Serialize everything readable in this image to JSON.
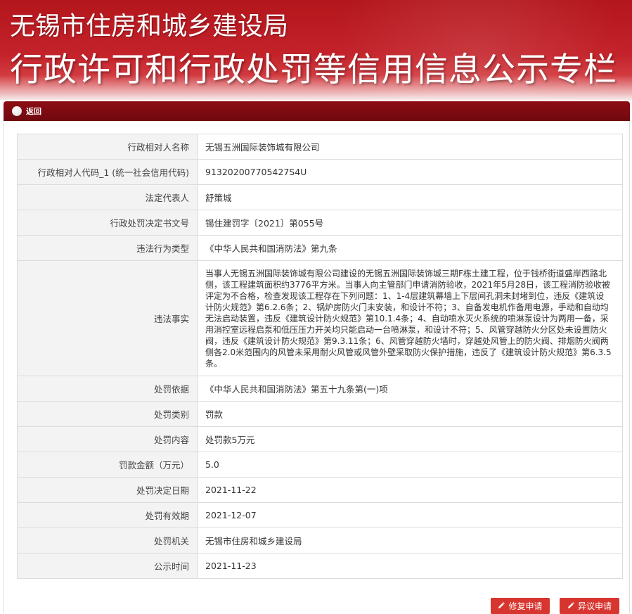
{
  "banner": {
    "line1": "无锡市住房和城乡建设局",
    "line2": "行政许可和行政处罚等信用信息公示专栏"
  },
  "panel": {
    "back_label": "返回"
  },
  "details": [
    {
      "label": "行政相对人名称",
      "value": "无锡五洲国际装饰城有限公司"
    },
    {
      "label": "行政相对人代码_1 (统一社会信用代码)",
      "value": "913202007705427S4U"
    },
    {
      "label": "法定代表人",
      "value": "舒策城"
    },
    {
      "label": "行政处罚决定书文号",
      "value": "锡住建罚字〔2021〕第055号"
    },
    {
      "label": "违法行为类型",
      "value": "《中华人民共和国消防法》第九条"
    },
    {
      "label": "违法事实",
      "value": "当事人无锡五洲国际装饰城有限公司建设的无锡五洲国际装饰城三期F栋土建工程，位于钱桥街道盛岸西路北侧，该工程建筑面积约3776平方米。当事人向主管部门申请消防验收，2021年5月28日，该工程消防验收被评定为不合格，检查发现该工程存在下列问题：1、1-4层建筑幕墙上下层间孔洞未封堵到位，违反《建筑设计防火规范》第6.2.6条；2、锅炉房防火门未安装，和设计不符；3、自备发电机作备用电源，手动和自动均无法启动装置，违反《建筑设计防火规范》第10.1.4条；4、自动喷水灭火系统的喷淋泵设计为两用一备，采用消控室远程启泵和低压压力开关均只能启动一台喷淋泵，和设计不符；5、风管穿越防火分区处未设置防火阀，违反《建筑设计防火规范》第9.3.11条；6、风管穿越防火墙时，穿越处风管上的防火阀、排烟防火阀两侧各2.0米范围内的风管未采用耐火风管或风管外壁采取防火保护措施，违反了《建筑设计防火规范》第6.3.5条。"
    },
    {
      "label": "处罚依据",
      "value": "《中华人民共和国消防法》第五十九条第(一)项"
    },
    {
      "label": "处罚类别",
      "value": "罚款"
    },
    {
      "label": "处罚内容",
      "value": "处罚款5万元"
    },
    {
      "label": "罚款金额（万元）",
      "value": "5.0"
    },
    {
      "label": "处罚决定日期",
      "value": "2021-11-22"
    },
    {
      "label": "处罚有效期",
      "value": "2021-12-07"
    },
    {
      "label": "处罚机关",
      "value": "无锡市住房和城乡建设局"
    },
    {
      "label": "公示时间",
      "value": "2021-11-23"
    }
  ],
  "actions": {
    "correction_label": "修复申请",
    "objection_label": "异议申请"
  }
}
